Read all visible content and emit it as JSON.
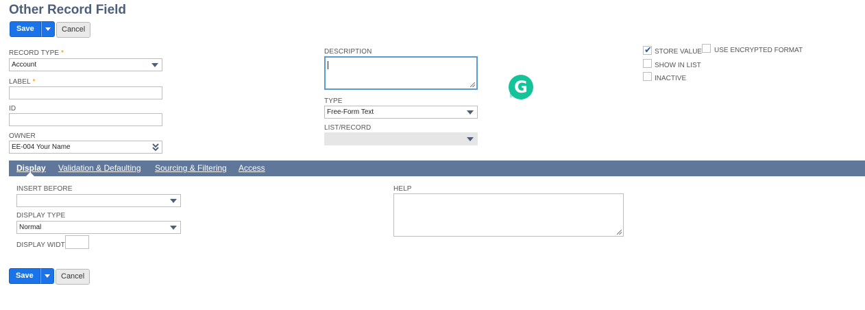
{
  "page": {
    "title": "Other Record Field"
  },
  "toolbar": {
    "save_label": "Save",
    "cancel_label": "Cancel"
  },
  "form": {
    "record_type": {
      "label": "RECORD TYPE",
      "required_mark": "*",
      "value": "Account"
    },
    "label_field": {
      "label": "LABEL",
      "required_mark": "*",
      "value": ""
    },
    "id_field": {
      "label": "ID",
      "value": ""
    },
    "owner": {
      "label": "OWNER",
      "value": "EE-004 Your Name"
    },
    "description": {
      "label": "DESCRIPTION",
      "value": ""
    },
    "type": {
      "label": "TYPE",
      "value": "Free-Form Text"
    },
    "list_record": {
      "label": "LIST/RECORD",
      "value": ""
    },
    "store_value": {
      "label": "STORE VALUE",
      "checked": true
    },
    "use_encrypted": {
      "label": "USE ENCRYPTED FORMAT",
      "checked": false
    },
    "show_in_list": {
      "label": "SHOW IN LIST",
      "checked": false
    },
    "inactive": {
      "label": "INACTIVE",
      "checked": false
    }
  },
  "tabs": [
    {
      "label": "Display",
      "active": true
    },
    {
      "label": "Validation & Defaulting",
      "active": false
    },
    {
      "label": "Sourcing & Filtering",
      "active": false
    },
    {
      "label": "Access",
      "active": false
    }
  ],
  "display_tab": {
    "insert_before": {
      "label": "INSERT BEFORE",
      "value": ""
    },
    "display_type": {
      "label": "DISPLAY TYPE",
      "value": "Normal"
    },
    "display_width": {
      "label": "DISPLAY WIDTH",
      "value": ""
    },
    "help": {
      "label": "HELP",
      "value": ""
    }
  },
  "icons": {
    "grammarly": "grammarly-icon",
    "dropdown": "caret-down-icon",
    "owner_dropdown": "double-chevron-down-icon"
  },
  "colors": {
    "primary": "#1a73e8",
    "tabbar": "#607799",
    "title": "#4d5f79",
    "grammarly": "#15c39a"
  }
}
